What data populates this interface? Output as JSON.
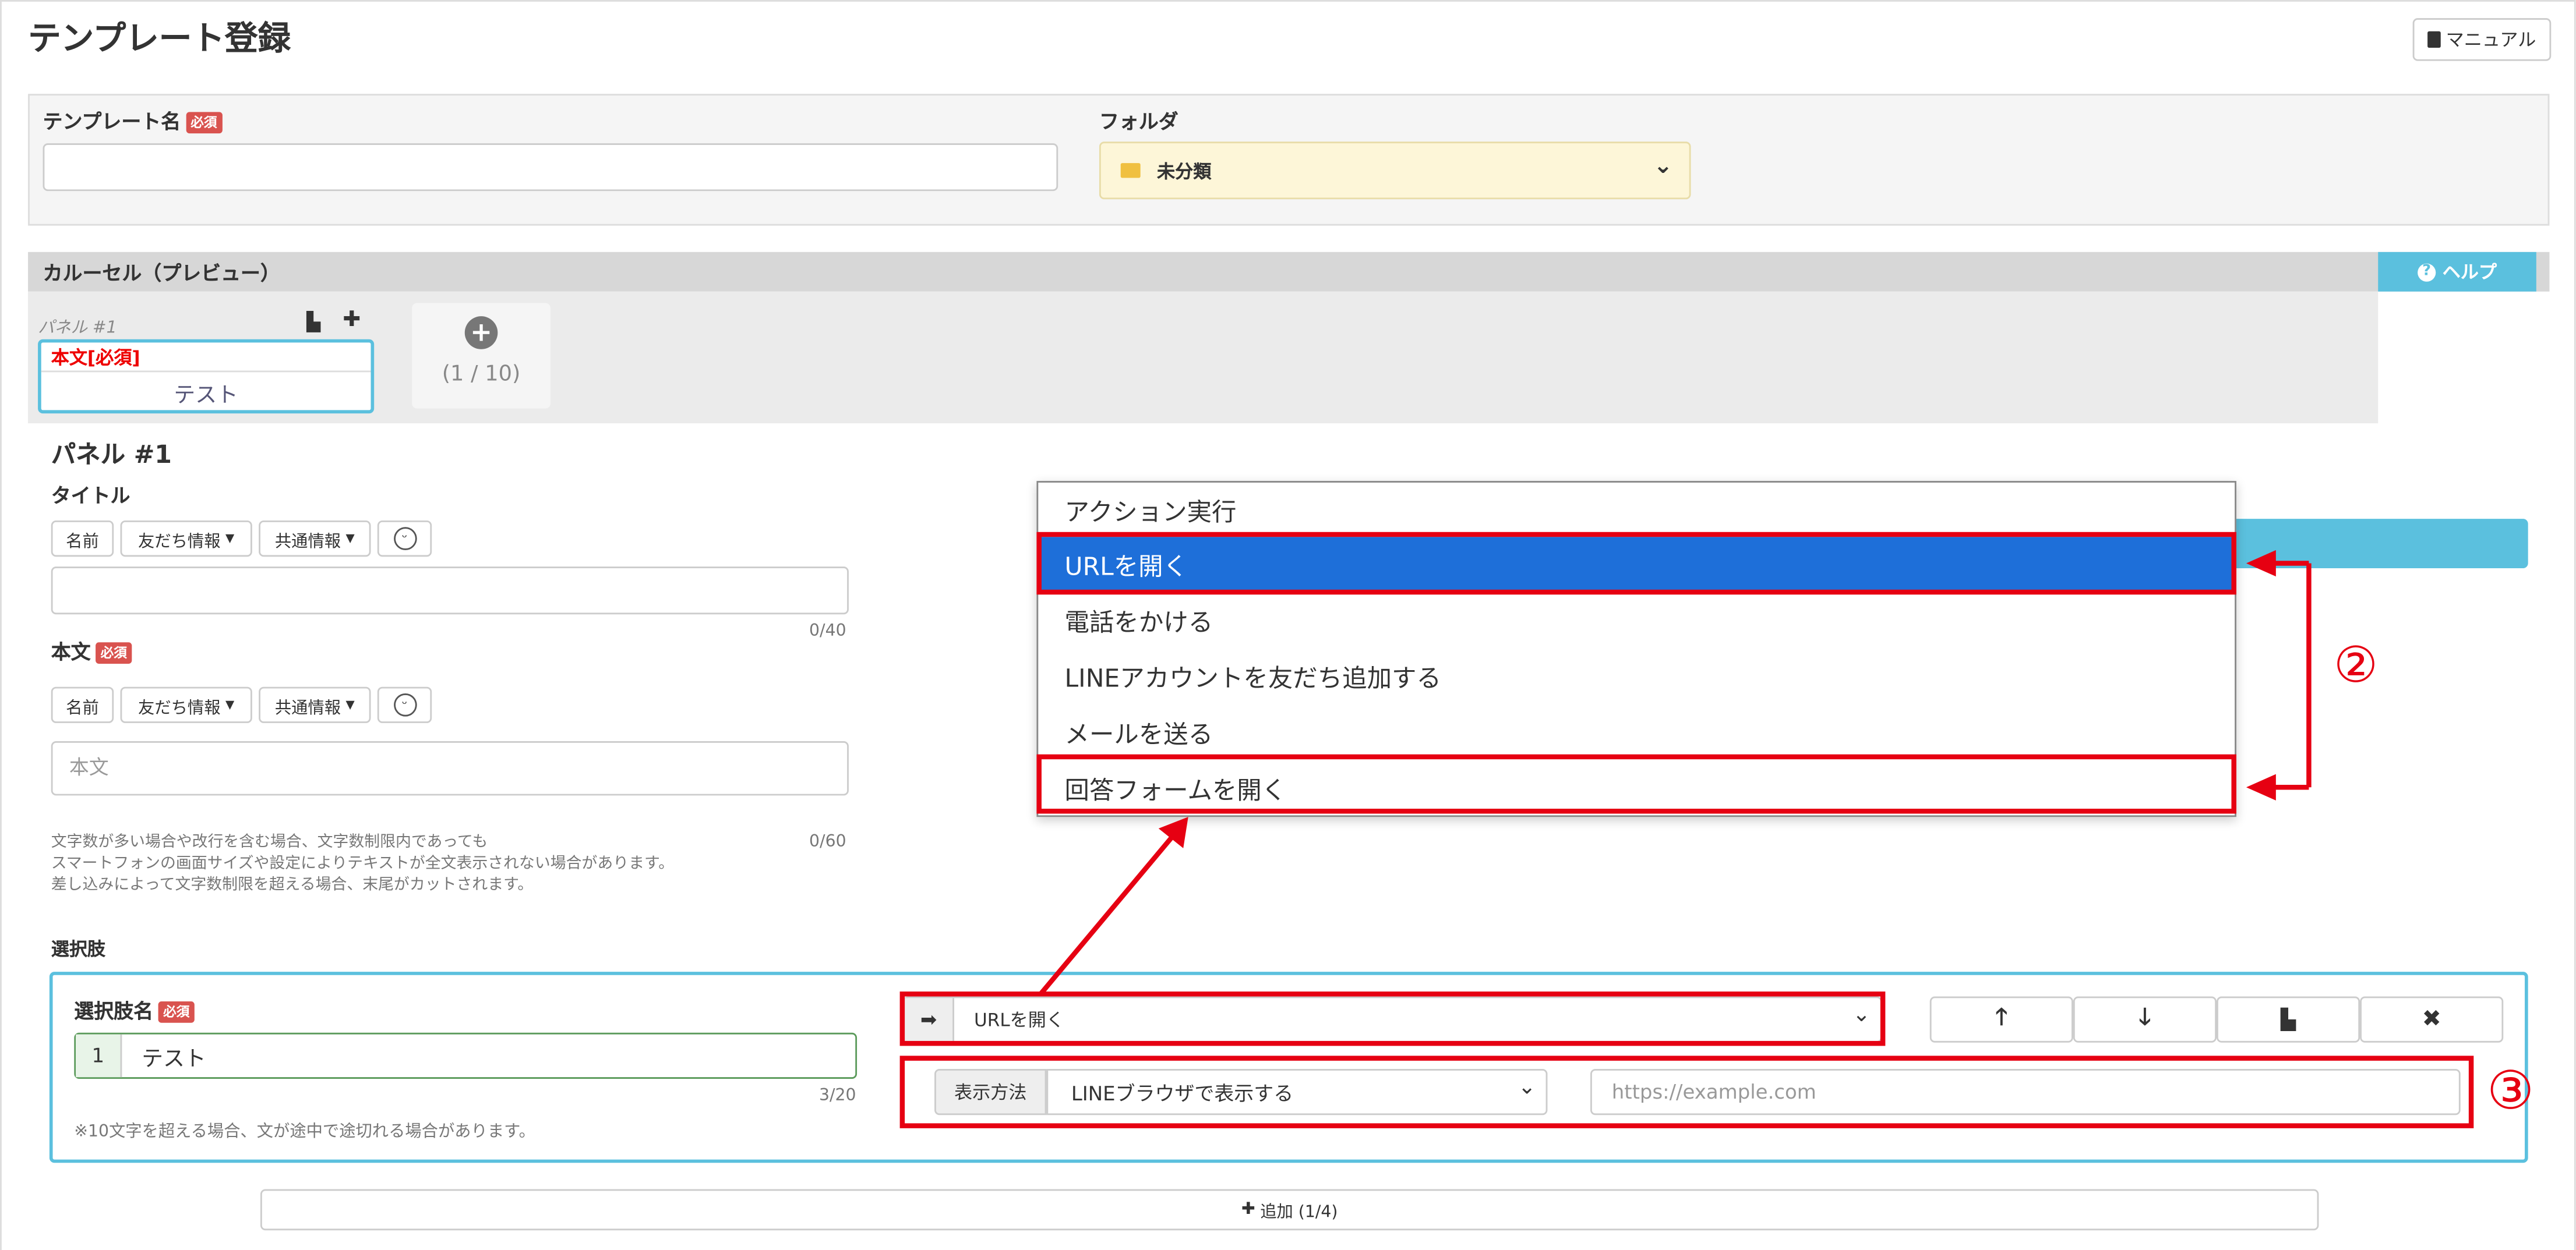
{
  "page": {
    "title": "テンプレート登録",
    "manual_label": "マニュアル"
  },
  "template_name": {
    "label": "テンプレート名",
    "required": "必須",
    "value": ""
  },
  "folder": {
    "label": "フォルダ",
    "selected": "未分類"
  },
  "carousel": {
    "header": "カルーセル（プレビュー）",
    "help_label": "ヘルプ",
    "panel_tab": {
      "name": "パネル #1",
      "body_label": "本文[必須]",
      "body_text": "テスト"
    },
    "add_counter": "(1 / 10)"
  },
  "panel": {
    "heading": "パネル #1",
    "title_label": "タイトル",
    "title_count": "0/40",
    "body_label": "本文",
    "body_required": "必須",
    "body_placeholder": "本文",
    "body_count": "0/60",
    "insert_buttons": {
      "name": "名前",
      "friend_info": "友だち情報",
      "common_info": "共通情報"
    },
    "notes": [
      "文字数が多い場合や改行を含む場合、文字数制限内であっても",
      "スマートフォンの画面サイズや設定によりテキストが全文表示されない場合があります。",
      "差し込みによって文字数制限を超える場合、末尾がカットされます。"
    ]
  },
  "choices": {
    "section_label": "選択肢",
    "name_label": "選択肢名",
    "required": "必須",
    "row_number": "1",
    "name_value": "テスト",
    "name_count": "3/20",
    "name_note": "※10文字を超える場合、文が途中で途切れる場合があります。",
    "action_selected": "URLを開く",
    "display_method_label": "表示方法",
    "display_method_value": "LINEブラウザで表示する",
    "url_placeholder": "https://example.com",
    "add_label": "追加 (1/4)"
  },
  "dropdown": {
    "options": [
      "アクション実行",
      "URLを開く",
      "電話をかける",
      "LINEアカウントを友だち追加する",
      "メールを送る",
      "回答フォームを開く"
    ],
    "highlighted_index": 1
  },
  "annotations": {
    "marker_2": "②",
    "marker_3": "③",
    "color": "#e60012"
  },
  "colors": {
    "required_badge": "#d9534f",
    "highlight": "#1e6fd9",
    "help_bg": "#5bc0de",
    "folder_bg": "#fdf6d8"
  }
}
